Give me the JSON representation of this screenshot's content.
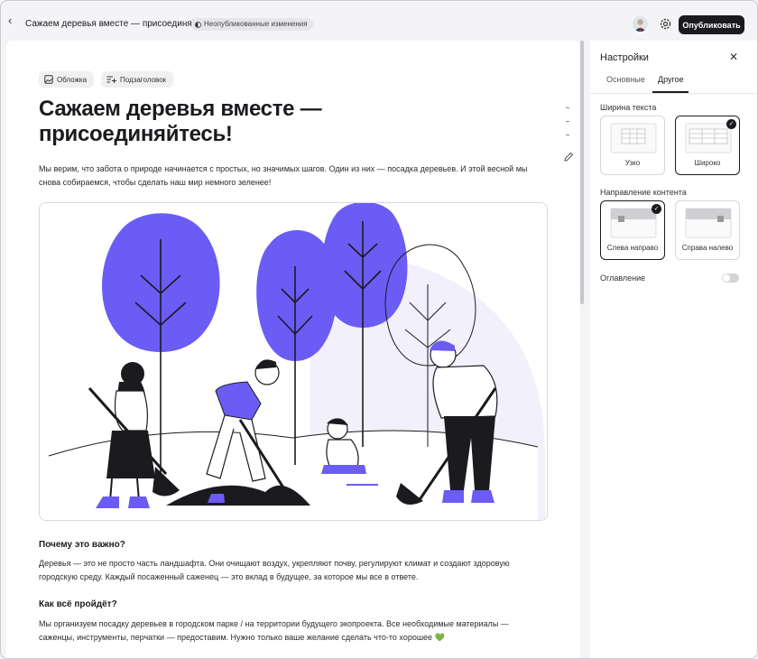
{
  "topbar": {
    "title": "Сажаем деревья вместе — присоединяйтесь!",
    "badge": "Неопубликованные изменения",
    "publish_label": "Опубликовать"
  },
  "editor": {
    "cover_label": "Обложка",
    "subtitle_label": "Подзаголовок",
    "heading": "Сажаем деревья вместе — присоединяйтесь!",
    "intro": "Мы верим, что забота о природе начинается с простых, но значимых шагов. Один из них — посадка деревьев. И этой весной мы снова собираемся, чтобы сделать наш мир немного зеленее!",
    "section1_title": "Почему это важно?",
    "section1_text": "Деревья — это не просто часть ландшафта. Они очищают воздух, укрепляют почву, регулируют климат и создают здоровую городскую среду. Каждый посаженный саженец — это вклад в будущее, за которое мы все в ответе.",
    "section2_title": "Как всё пройдёт?",
    "section2_text": "Мы организуем посадку деревьев в городском парке / на территории будущего экопроекта. Все необходимые материалы — саженцы, инструменты, перчатки — предоставим. Нужно только ваше желание сделать что-то хорошее 💚"
  },
  "settings": {
    "title": "Настройки",
    "tabs": [
      "Основные",
      "Другое"
    ],
    "active_tab": "Другое",
    "text_width": {
      "label": "Ширина текста",
      "options": [
        "Узко",
        "Широко"
      ],
      "selected": "Широко"
    },
    "content_direction": {
      "label": "Направление контента",
      "options": [
        "Слева направо",
        "Справа налево"
      ],
      "selected": "Слева направо"
    },
    "toc": {
      "label": "Оглавление",
      "enabled": false
    }
  },
  "colors": {
    "accent": "#6a5cf4",
    "dark": "#1b1b1f",
    "panel_bg": "#ffffff",
    "app_bg": "#f4f4f6"
  }
}
